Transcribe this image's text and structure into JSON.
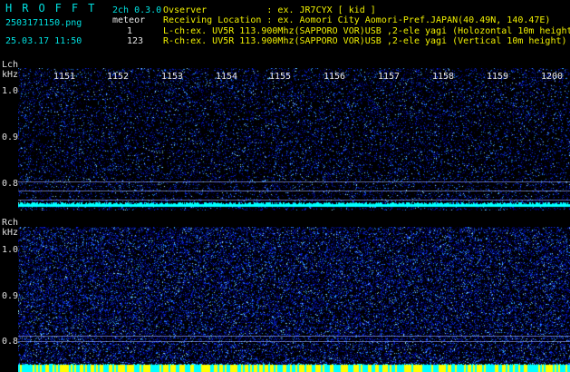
{
  "brand": "HROFFT",
  "file": {
    "name": "2503171150.png",
    "timestamp": "25.03.17 11:50"
  },
  "mode": {
    "label": "2ch 0.3.0",
    "type": "meteor",
    "lch_count": "1",
    "rch_count": "123"
  },
  "info": {
    "observer": "Ovserver           : ex. JR7CYX [ kid ]",
    "location": "Receiving Location : ex. Aomori City Aomori-Pref.JAPAN(40.49N, 140.47E)",
    "lch": "L-ch:ex. UV5R 113.900Mhz(SAPPORO VOR)USB ,2-ele yagi (Holozontal 10m height)",
    "rch": "R-ch:ex. UV5R 113.900Mhz(SAPPORO VOR)USB ,2-ele yagi (Vertical 10m height)"
  },
  "time_axis": [
    "1151",
    "1152",
    "1153",
    "1154",
    "1155",
    "1156",
    "1157",
    "1158",
    "1159",
    "1200"
  ],
  "lch": {
    "label": "Lch",
    "unit": "kHz",
    "freq_ticks": [
      "1.0",
      "0.9",
      "0.8"
    ]
  },
  "rch": {
    "label": "Rch",
    "unit": "kHz",
    "freq_ticks": [
      "1.0",
      "0.9",
      "0.8"
    ]
  },
  "colors": {
    "header_text": "#f0f000",
    "accent_text": "#00e0e0",
    "noise_low": "#000060",
    "noise_mid": "#1030c0",
    "noise_high": "#40c0ff",
    "bottom_trace_l": "#00ffff",
    "bottom_trace_r": "#ffff00"
  }
}
